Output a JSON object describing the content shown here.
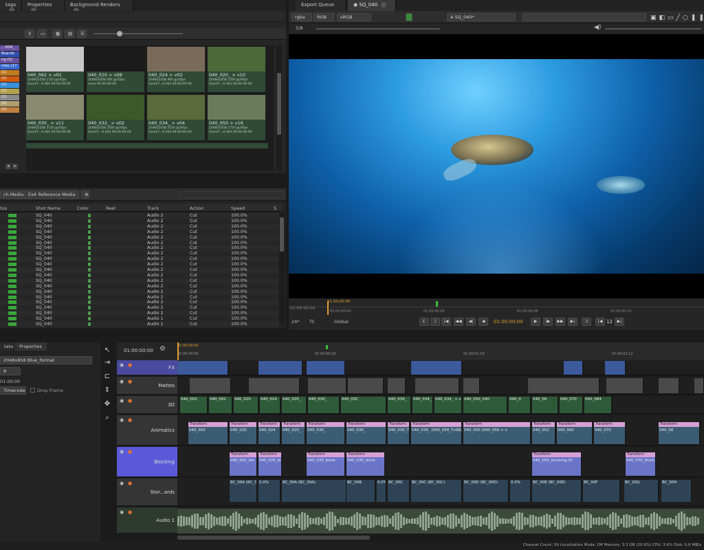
{
  "top_tabs": [
    "tags",
    "Properties",
    "Background Renders"
  ],
  "viewer_tabs": [
    "Export Queue",
    "SQ_040"
  ],
  "viewer": {
    "channel": "rgba",
    "color_space": "RGB",
    "display": "sRGB",
    "shot": "A  SQ_040*",
    "frame_field": "5/8",
    "timecode_start": "01:00:00:00",
    "playhead_time": "01:00:00:00",
    "current_time": "01:00:00:00",
    "fps": "24*",
    "tc_mode": "TC",
    "scope": "Global",
    "step": "12",
    "ruler": [
      "01:00:00:00",
      "01:00:00:04",
      "01:00:00:08",
      "01:00:00:12"
    ]
  },
  "bins": [
    "...V09_",
    "Boards",
    "ng (5)",
    "mbs (17",
    "(1)",
    "(1)",
    "(1)",
    "(1)",
    "(1)",
    "(2)",
    "(1)"
  ],
  "bin_colors": [
    "#6a4fa0",
    "#2f4fb0",
    "#6a4fa0",
    "#3a6ad0",
    "#c07a20",
    "#d05a10",
    "#3a90d8",
    "#b0a050",
    "#8a8a8a",
    "#b0a070",
    "#c08040"
  ],
  "thumbnails": [
    {
      "name": "040_062 > v01",
      "m1": "2048x1058  115f @24fps",
      "m2": "QuickT...H.264 00:00:00:00",
      "m3": "",
      "bg": "#c8c8c8"
    },
    {
      "name": "040_010 > v08",
      "m1": "2048x1058  68f @25fps",
      "m2": "none  00:00:00:00",
      "m3": "",
      "bg": "#1a1a1a"
    },
    {
      "name": "040_024 > v02",
      "m1": "2048x1058  90f @24fps",
      "m2": "QuickT...H.264 00:00:00:00",
      "m3": "",
      "bg": "#7a6a5a"
    },
    {
      "name": "040_020_ > v10",
      "m1": "2048x1058  120f @24fps",
      "m2": "QuickT...H.264 00:00:00:00",
      "m3": "",
      "bg": "#4a6a3a"
    },
    {
      "name": "040_030_ > v11",
      "m1": "2048x1058  333f @24fps",
      "m2": "QuickT...H.264 00:00:00:00",
      "m3": "",
      "bg": "#8a8a70"
    },
    {
      "name": "040_032_ > v02",
      "m1": "2048x1058  156f @24fps",
      "m2": "QuickT...H.264 00:00:00:00",
      "m3": "",
      "bg": "#3a5a2a"
    },
    {
      "name": "040_034_ > v04",
      "m1": "2048x1058  233f @24fps",
      "m2": "QuickT...H.264 00:00:00:00",
      "m3": "",
      "bg": "#5a6a3a"
    },
    {
      "name": "040_050 > v16",
      "m1": "2048x1058  175f @24fps",
      "m2": "QuickT...H.264 00:00:00:00",
      "m3": "",
      "bg": "#6a7a5a"
    }
  ],
  "grid_buttons": {
    "match_media": "ch Media",
    "edit_reference": "Exit Reference Media"
  },
  "table": {
    "headers": [
      "tus",
      "Shot Name",
      "Color",
      "Reel",
      "Track",
      "Action",
      "Speed",
      "S"
    ],
    "rows": [
      [
        "SQ_040",
        "Audio 2",
        "Cut",
        "100.0%"
      ],
      [
        "SQ_040",
        "Audio 2",
        "Cut",
        "100.0%"
      ],
      [
        "SQ_040",
        "Audio 2",
        "Cut",
        "100.0%"
      ],
      [
        "SQ_040",
        "Audio 2",
        "Cut",
        "100.0%"
      ],
      [
        "SQ_040",
        "Audio 2",
        "Cut",
        "100.0%"
      ],
      [
        "SQ_040",
        "Audio 2",
        "Cut",
        "100.0%"
      ],
      [
        "SQ_040",
        "Audio 2",
        "Cut",
        "100.0%"
      ],
      [
        "SQ_040",
        "Audio 2",
        "Cut",
        "100.0%"
      ],
      [
        "SQ_040",
        "Audio 2",
        "Cut",
        "100.0%"
      ],
      [
        "SQ_040",
        "Audio 2",
        "Cut",
        "100.0%"
      ],
      [
        "SQ_040",
        "Audio 2",
        "Cut",
        "100.0%"
      ],
      [
        "SQ_040",
        "Audio 2",
        "Cut",
        "100.0%"
      ],
      [
        "SQ_040",
        "Audio 2",
        "Cut",
        "100.0%"
      ],
      [
        "SQ_040",
        "Audio 2",
        "Cut",
        "100.0%"
      ],
      [
        "SQ_040",
        "Audio 2",
        "Cut",
        "100.0%"
      ],
      [
        "SQ_040",
        "Audio 2",
        "Cut",
        "100.0%"
      ],
      [
        "SQ_040",
        "Audio 2",
        "Cut",
        "100.0%"
      ],
      [
        "SQ_040",
        "Audio 2",
        "Cut",
        "100.0%"
      ],
      [
        "SQ_040",
        "Audio 2",
        "Cut",
        "100.0%"
      ],
      [
        "SQ_040",
        "Audio 1",
        "Cut",
        "100.0%"
      ],
      [
        "SQ_040",
        "Audio 1",
        "Cut",
        "100.0%"
      ]
    ]
  },
  "props": {
    "tabs": [
      "tate",
      "Properties"
    ],
    "format": "2048x858 Blue_format",
    "field1": "8",
    "field2": "01:00:00",
    "field3": "Timecode",
    "drop_frame": "Drop Frame"
  },
  "timeline": {
    "timecode": "01:00:00:00",
    "ruler": [
      "01:00:00:00",
      "01:00:00:20",
      "01:00:01:16",
      "01:00:02:12"
    ],
    "tracks": [
      "FX",
      "Mattes",
      "3D",
      "Animatics",
      "Blocking",
      "Stor...ards",
      "Audio 1"
    ],
    "clips_3d": [
      "040_002",
      "040_002",
      "040_020",
      "040_024",
      "040_020_",
      "040_030_",
      "040_03C",
      "040_030_",
      "040_034_",
      "040_034_ > v04_040",
      "040_050_040",
      "040_0",
      "040_06",
      "040_070",
      "040_084"
    ],
    "clips_anim": [
      "040_002",
      "040_020",
      "040_024",
      "040_020_",
      "040_030_",
      "040_030_",
      "040_030_Tv06",
      "040_034_ (040_034_Tv08)",
      "040_050 (040_050 > v",
      "040_052",
      "040_060",
      "040_070",
      "040_08"
    ],
    "clips_block": [
      "040_002_blo",
      "040_020_blo",
      "040_020_block",
      "040_030_block",
      "040_050_blocking.01",
      "040_070_block"
    ],
    "clips_story": [
      "BC_00A (BC_00A)",
      "0.0%",
      "BC_00A (BC_00A)",
      "BC_00B",
      "0.0%",
      "BC_00C",
      "BC_00C (BC_00C)",
      "BC_00D (BC_00D)",
      "0.0%",
      "BC_00E (BC_00E)",
      "BC_00F",
      "BC_00G",
      "BC_00H"
    ],
    "transform_label": "Transform",
    "transform2_label": "Transform2"
  },
  "status_bar": "Channel Count: 59  Localization Mode: Off  Memory: 3.3 GB (20.9%)  CPU: 3.6%  Disk: 0.6 MB/s"
}
